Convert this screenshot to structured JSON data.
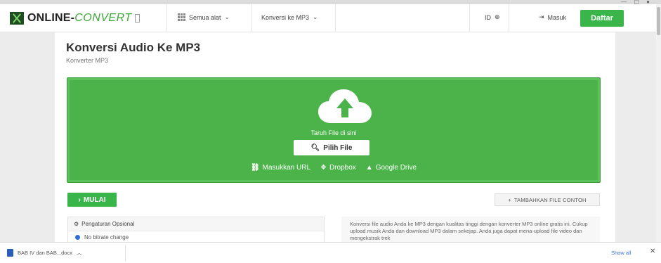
{
  "navbar": {
    "logo_main": "ONLINE-",
    "logo_accent": "CONVERT",
    "all_tools": "Semua alat",
    "converter_menu": "Konversi ke MP3",
    "language": "ID",
    "login": "Masuk",
    "signup": "Daftar"
  },
  "page": {
    "title": "Konversi Audio Ke MP3",
    "subtitle": "Konverter MP3"
  },
  "dropzone": {
    "drop_text": "Taruh File di sini",
    "pick_file": "Pilih File",
    "url_label": "Masukkan URL",
    "dropbox_label": "Dropbox",
    "gdrive_label": "Google Drive"
  },
  "actions": {
    "start": "MULAI",
    "add_sample": "TAMBAHKAN FILE CONTOH"
  },
  "options": {
    "header": "Pengaturan Opsional",
    "first_option": "No bitrate change"
  },
  "description": "Konversi file audio Anda ke MP3 dengan kualitas tinggi dengan konverter MP3 online gratis ini. Cukup upload musik Anda dan download MP3 dalam sekejap. Anda juga dapat mena-upload file video dan mengekstrak trek",
  "download_bar": {
    "file_name": "BAB IV dan BAB...docx",
    "show_all": "Show all"
  },
  "colors": {
    "brand_green": "#3ab54a",
    "dropzone_green": "#4bb349",
    "radio_blue": "#2f6fd6"
  }
}
